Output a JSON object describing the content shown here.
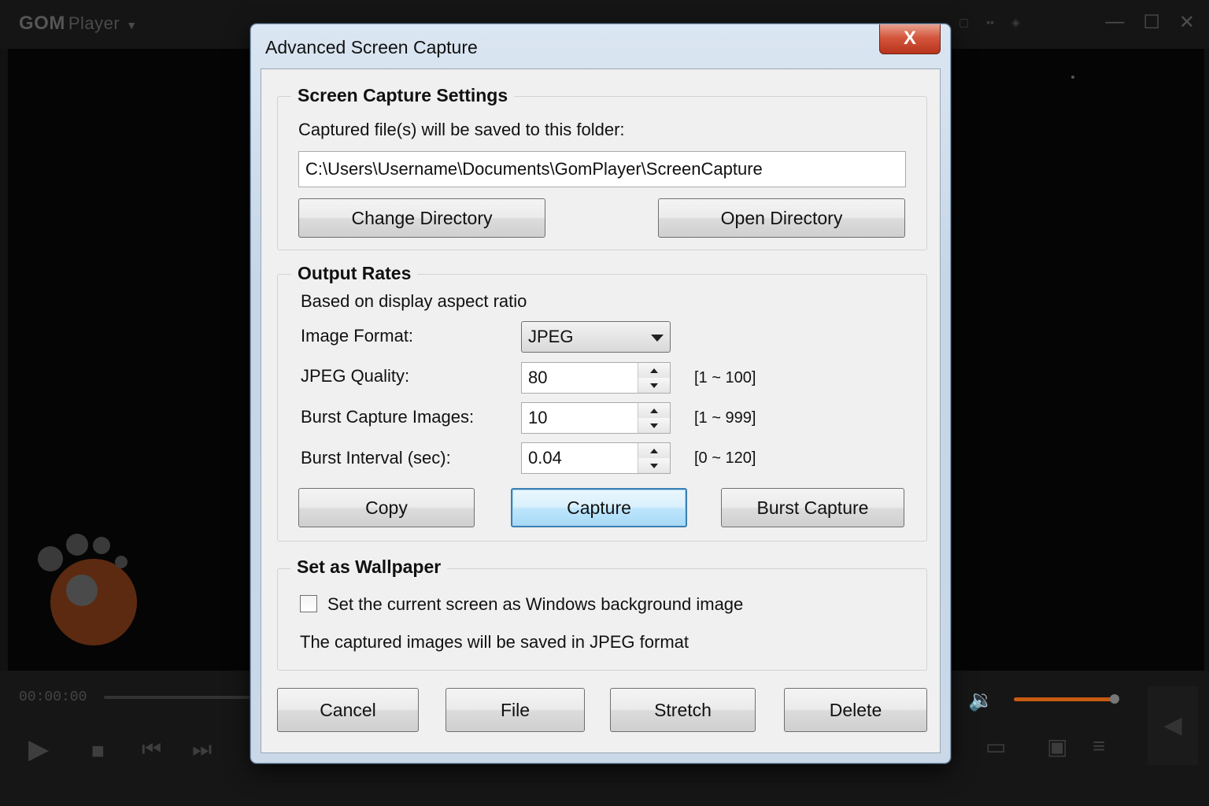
{
  "background_app": {
    "logo": "GOM",
    "logo_sub": "Player",
    "time": "00:00:00"
  },
  "dialog": {
    "title": "Advanced Screen Capture",
    "close_label": "X",
    "screen_capture": {
      "group_title": "Screen Capture Settings",
      "folder_label": "Captured file(s) will be saved to this folder:",
      "folder_path": "C:\\Users\\Username\\Documents\\GomPlayer\\ScreenCapture",
      "change_dir_label": "Change Directory",
      "open_dir_label": "Open Directory"
    },
    "output_rates": {
      "group_title": "Output Rates",
      "subtitle": "Based on display aspect ratio",
      "image_format_label": "Image Format:",
      "image_format_value": "JPEG",
      "jpeg_quality_label": "JPEG Quality:",
      "jpeg_quality_value": "80",
      "jpeg_quality_range": "[1 ~ 100]",
      "burst_images_label": "Burst Capture Images:",
      "burst_images_value": "10",
      "burst_images_range": "[1 ~ 999]",
      "burst_interval_label": "Burst Interval (sec):",
      "burst_interval_value": "0.04",
      "burst_interval_range": "[0 ~ 120]",
      "copy_label": "Copy",
      "capture_label": "Capture",
      "burst_capture_label": "Burst Capture"
    },
    "wallpaper": {
      "group_title": "Set as Wallpaper",
      "checkbox_label": "Set the current screen as Windows background image",
      "checkbox_checked": false,
      "note": "The captured images will be saved in JPEG format"
    },
    "footer": {
      "cancel_label": "Cancel",
      "file_label": "File",
      "stretch_label": "Stretch",
      "delete_label": "Delete"
    }
  },
  "colors": {
    "accent_orange": "#c85a12",
    "close_red": "#c8432a",
    "default_button_border": "#3c7fb1"
  }
}
